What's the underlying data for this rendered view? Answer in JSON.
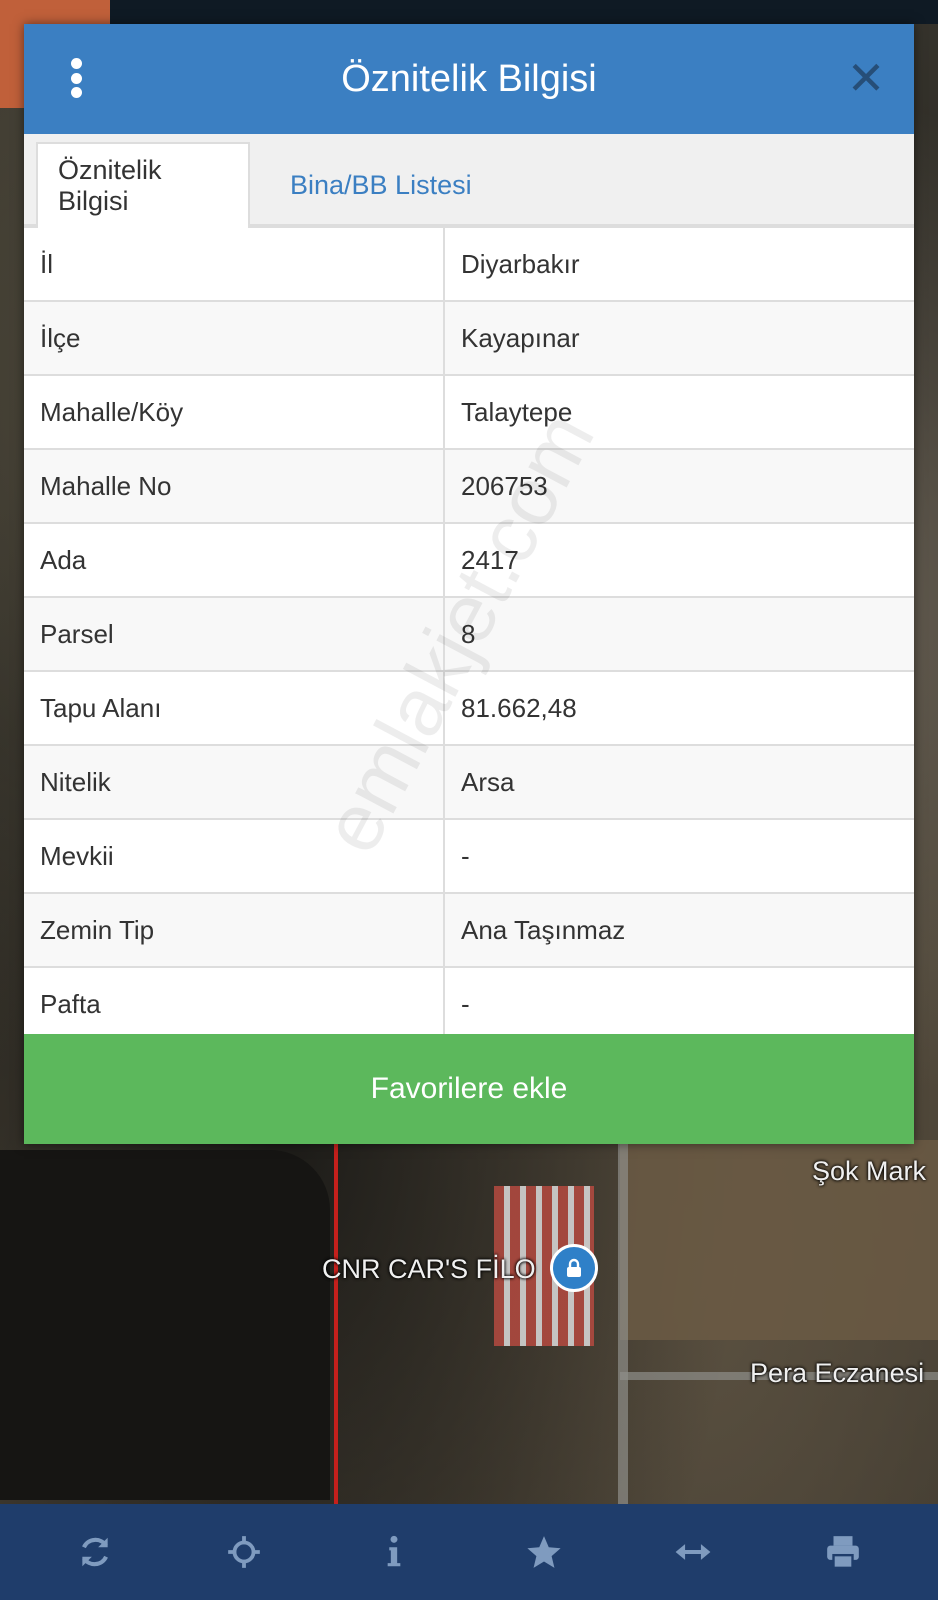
{
  "dialog": {
    "title": "Öznitelik Bilgisi",
    "tabs": [
      {
        "label": "Öznitelik Bilgisi",
        "active": true
      },
      {
        "label": "Bina/BB Listesi",
        "active": false
      }
    ],
    "rows": [
      {
        "key": "İl",
        "value": "Diyarbakır"
      },
      {
        "key": "İlçe",
        "value": "Kayapınar"
      },
      {
        "key": "Mahalle/Köy",
        "value": "Talaytepe"
      },
      {
        "key": "Mahalle No",
        "value": "206753"
      },
      {
        "key": "Ada",
        "value": "2417"
      },
      {
        "key": "Parsel",
        "value": "8"
      },
      {
        "key": "Tapu Alanı",
        "value": "81.662,48"
      },
      {
        "key": "Nitelik",
        "value": "Arsa"
      },
      {
        "key": "Mevkii",
        "value": "-"
      },
      {
        "key": "Zemin Tip",
        "value": "Ana Taşınmaz"
      },
      {
        "key": "Pafta",
        "value": "-"
      }
    ],
    "favorite_label": "Favorilere ekle",
    "watermark": "emlakjet.com"
  },
  "map": {
    "labels": {
      "shop": "Şok Mark",
      "cars": "CNR CAR'S FİLO",
      "pharmacy": "Pera Eczanesi"
    }
  },
  "toolbar": {
    "icons": [
      "refresh-icon",
      "locate-icon",
      "info-icon",
      "star-icon",
      "measure-icon",
      "print-icon"
    ]
  },
  "colors": {
    "header": "#3b7fc2",
    "favorite": "#5cb85c",
    "toolbar": "#1f3d6b",
    "close": "#264e78"
  }
}
